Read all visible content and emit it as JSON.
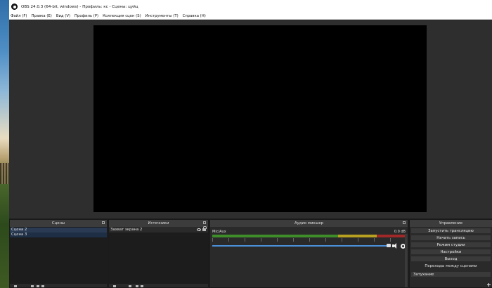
{
  "window": {
    "title": "OBS 24.0.3 (64-bit, windows) - Профиль: кс - Сцены: цуйц"
  },
  "menu": [
    {
      "label": "Файл (F)"
    },
    {
      "label": "Правка (E)"
    },
    {
      "label": "Вид (V)"
    },
    {
      "label": "Профиль (P)"
    },
    {
      "label": "Коллекция сцен (S)"
    },
    {
      "label": "Инструменты (T)"
    },
    {
      "label": "Справка (H)"
    }
  ],
  "scenes": {
    "title": "Сцены",
    "items": [
      {
        "label": "Сцена 2"
      },
      {
        "label": "Сцена 3"
      }
    ]
  },
  "sources": {
    "title": "Источники",
    "items": [
      {
        "label": "Захват экрана 2"
      }
    ]
  },
  "mixer": {
    "title": "Аудио микшер",
    "channel": "Mic/Aux",
    "level": "0.0 dB"
  },
  "controls": {
    "title": "Управление",
    "buttons": [
      {
        "label": "Запустить трансляцию"
      },
      {
        "label": "Начать запись"
      },
      {
        "label": "Режим студии"
      },
      {
        "label": "Настройки"
      },
      {
        "label": "Выход"
      }
    ]
  },
  "transitions": {
    "title": "Переходы между сценами",
    "selected": "Затухание"
  },
  "colors": {
    "canvas": "#000000",
    "panel": "#2a2a2a",
    "selection": "#2a3a52",
    "volume": "#4a8fd8"
  }
}
